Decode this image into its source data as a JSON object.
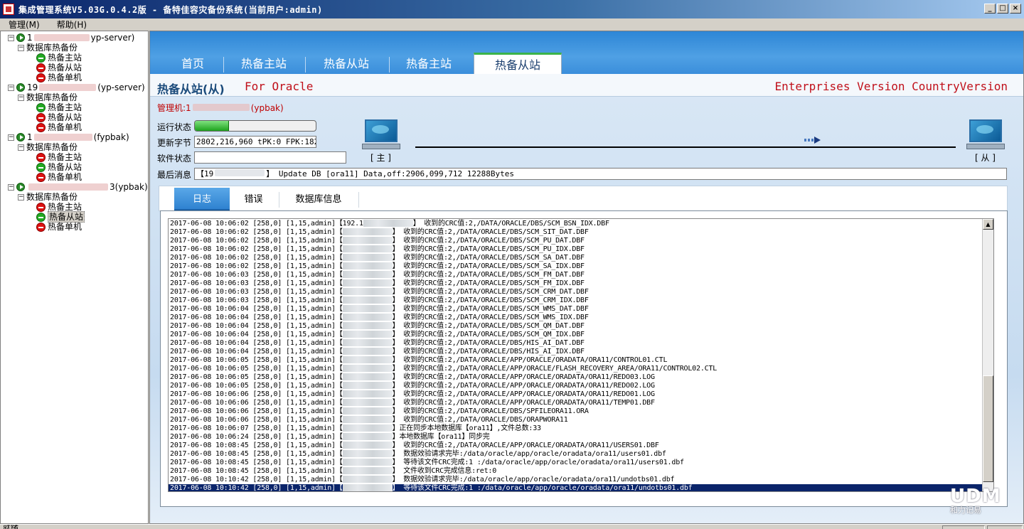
{
  "window": {
    "title": "集成管理系统V5.03G.0.4.2版 - 备特佳容灾备份系统(当前用户:admin)",
    "minimize": "_",
    "maximize": "□",
    "close": "×"
  },
  "menu": [
    {
      "label": "管理(M)"
    },
    {
      "label": "帮助(H)"
    }
  ],
  "tree": {
    "servers": [
      {
        "prefix": "1",
        "suffix": "yp-server)",
        "group": "数据库热备份",
        "children": [
          {
            "label": "热备主站",
            "status": "green"
          },
          {
            "label": "热备从站",
            "status": "red"
          },
          {
            "label": "热备单机",
            "status": "red"
          }
        ]
      },
      {
        "prefix": "19",
        "suffix": "(yp-server)",
        "group": "数据库热备份",
        "children": [
          {
            "label": "热备主站",
            "status": "green"
          },
          {
            "label": "热备从站",
            "status": "red"
          },
          {
            "label": "热备单机",
            "status": "red"
          }
        ]
      },
      {
        "prefix": "1",
        "suffix": "(fypbak)",
        "group": "数据库热备份",
        "children": [
          {
            "label": "热备主站",
            "status": "red"
          },
          {
            "label": "热备从站",
            "status": "green"
          },
          {
            "label": "热备单机",
            "status": "red"
          }
        ]
      },
      {
        "prefix": "",
        "suffix": "3(ypbak)",
        "group": "数据库热备份",
        "children": [
          {
            "label": "热备主站",
            "status": "red"
          },
          {
            "label": "热备从站",
            "status": "green",
            "selected": true
          },
          {
            "label": "热备单机",
            "status": "red"
          }
        ]
      }
    ]
  },
  "top_tabs": [
    {
      "label": "首页"
    },
    {
      "label": "热备主站"
    },
    {
      "label": "热备从站"
    },
    {
      "label": "热备主站"
    },
    {
      "label": "热备从站",
      "active": true
    }
  ],
  "header": {
    "title": "热备从站(从)",
    "subtitle": "For Oracle",
    "edition": "Enterprises Version CountryVersion"
  },
  "status_panel": {
    "manager_prefix": "管理机:1",
    "manager_suffix": "(ypbak)",
    "run_status_label": "运行状态",
    "run_progress": 0.28,
    "update_bytes_label": "更新字节",
    "update_bytes_value": "2802,216,960  tPK:0  FPK:18243",
    "software_status_label": "软件状态",
    "software_status_value": "",
    "last_message_label": "最后消息",
    "last_message_prefix": "【19",
    "last_message_text": "】 Update DB [ora11] Data,off:2906,099,712  12288Bytes",
    "master_label": "[ 主 ]",
    "slave_label": "[ 从 ]"
  },
  "inner_tabs": [
    {
      "label": "日志",
      "active": true
    },
    {
      "label": "错误"
    },
    {
      "label": "数据库信息"
    }
  ],
  "log": [
    {
      "ts": "2017-06-08 10:06:02",
      "code": "[258,0]",
      "user": "[1,15,admin]",
      "ip": "【192.1",
      "msg": "】 收到的CRC值:2,/DATA/ORACLE/DBS/SCM_BSN_IDX.DBF"
    },
    {
      "ts": "2017-06-08 10:06:02",
      "code": "[258,0]",
      "user": "[1,15,admin]",
      "ip": "【",
      "msg": "】 收到的CRC值:2,/DATA/ORACLE/DBS/SCM_SIT_DAT.DBF"
    },
    {
      "ts": "2017-06-08 10:06:02",
      "code": "[258,0]",
      "user": "[1,15,admin]",
      "ip": "【",
      "msg": "】 收到的CRC值:2,/DATA/ORACLE/DBS/SCM_PU_DAT.DBF"
    },
    {
      "ts": "2017-06-08 10:06:02",
      "code": "[258,0]",
      "user": "[1,15,admin]",
      "ip": "【",
      "msg": "】 收到的CRC值:2,/DATA/ORACLE/DBS/SCM_PU_IDX.DBF"
    },
    {
      "ts": "2017-06-08 10:06:02",
      "code": "[258,0]",
      "user": "[1,15,admin]",
      "ip": "【",
      "msg": "】 收到的CRC值:2,/DATA/ORACLE/DBS/SCM_SA_DAT.DBF"
    },
    {
      "ts": "2017-06-08 10:06:02",
      "code": "[258,0]",
      "user": "[1,15,admin]",
      "ip": "【",
      "msg": "】 收到的CRC值:2,/DATA/ORACLE/DBS/SCM_SA_IDX.DBF"
    },
    {
      "ts": "2017-06-08 10:06:03",
      "code": "[258,0]",
      "user": "[1,15,admin]",
      "ip": "【",
      "msg": "】 收到的CRC值:2,/DATA/ORACLE/DBS/SCM_FM_DAT.DBF"
    },
    {
      "ts": "2017-06-08 10:06:03",
      "code": "[258,0]",
      "user": "[1,15,admin]",
      "ip": "【",
      "msg": "】 收到的CRC值:2,/DATA/ORACLE/DBS/SCM_FM_IDX.DBF"
    },
    {
      "ts": "2017-06-08 10:06:03",
      "code": "[258,0]",
      "user": "[1,15,admin]",
      "ip": "【",
      "msg": "】 收到的CRC值:2,/DATA/ORACLE/DBS/SCM_CRM_DAT.DBF"
    },
    {
      "ts": "2017-06-08 10:06:03",
      "code": "[258,0]",
      "user": "[1,15,admin]",
      "ip": "【",
      "msg": "】 收到的CRC值:2,/DATA/ORACLE/DBS/SCM_CRM_IDX.DBF"
    },
    {
      "ts": "2017-06-08 10:06:04",
      "code": "[258,0]",
      "user": "[1,15,admin]",
      "ip": "【",
      "msg": "】 收到的CRC值:2,/DATA/ORACLE/DBS/SCM_WMS_DAT.DBF"
    },
    {
      "ts": "2017-06-08 10:06:04",
      "code": "[258,0]",
      "user": "[1,15,admin]",
      "ip": "【",
      "msg": "】 收到的CRC值:2,/DATA/ORACLE/DBS/SCM_WMS_IDX.DBF"
    },
    {
      "ts": "2017-06-08 10:06:04",
      "code": "[258,0]",
      "user": "[1,15,admin]",
      "ip": "【",
      "msg": "】 收到的CRC值:2,/DATA/ORACLE/DBS/SCM_QM_DAT.DBF"
    },
    {
      "ts": "2017-06-08 10:06:04",
      "code": "[258,0]",
      "user": "[1,15,admin]",
      "ip": "【",
      "msg": "】 收到的CRC值:2,/DATA/ORACLE/DBS/SCM_QM_IDX.DBF"
    },
    {
      "ts": "2017-06-08 10:06:04",
      "code": "[258,0]",
      "user": "[1,15,admin]",
      "ip": "【",
      "msg": "】 收到的CRC值:2,/DATA/ORACLE/DBS/HIS_AI_DAT.DBF"
    },
    {
      "ts": "2017-06-08 10:06:04",
      "code": "[258,0]",
      "user": "[1,15,admin]",
      "ip": "【",
      "msg": "】 收到的CRC值:2,/DATA/ORACLE/DBS/HIS_AI_IDX.DBF"
    },
    {
      "ts": "2017-06-08 10:06:05",
      "code": "[258,0]",
      "user": "[1,15,admin]",
      "ip": "【",
      "msg": "】 收到的CRC值:2,/DATA/ORACLE/APP/ORACLE/ORADATA/ORA11/CONTROL01.CTL"
    },
    {
      "ts": "2017-06-08 10:06:05",
      "code": "[258,0]",
      "user": "[1,15,admin]",
      "ip": "【",
      "msg": "】 收到的CRC值:2,/DATA/ORACLE/APP/ORACLE/FLASH_RECOVERY_AREA/ORA11/CONTROL02.CTL"
    },
    {
      "ts": "2017-06-08 10:06:05",
      "code": "[258,0]",
      "user": "[1,15,admin]",
      "ip": "【",
      "msg": "】 收到的CRC值:2,/DATA/ORACLE/APP/ORACLE/ORADATA/ORA11/REDO03.LOG"
    },
    {
      "ts": "2017-06-08 10:06:05",
      "code": "[258,0]",
      "user": "[1,15,admin]",
      "ip": "【",
      "msg": "】 收到的CRC值:2,/DATA/ORACLE/APP/ORACLE/ORADATA/ORA11/REDO02.LOG"
    },
    {
      "ts": "2017-06-08 10:06:06",
      "code": "[258,0]",
      "user": "[1,15,admin]",
      "ip": "【",
      "msg": "】 收到的CRC值:2,/DATA/ORACLE/APP/ORACLE/ORADATA/ORA11/REDO01.LOG"
    },
    {
      "ts": "2017-06-08 10:06:06",
      "code": "[258,0]",
      "user": "[1,15,admin]",
      "ip": "【",
      "msg": "】 收到的CRC值:2,/DATA/ORACLE/APP/ORACLE/ORADATA/ORA11/TEMP01.DBF"
    },
    {
      "ts": "2017-06-08 10:06:06",
      "code": "[258,0]",
      "user": "[1,15,admin]",
      "ip": "【",
      "msg": "】 收到的CRC值:2,/DATA/ORACLE/DBS/SPFILEORA11.ORA"
    },
    {
      "ts": "2017-06-08 10:06:06",
      "code": "[258,0]",
      "user": "[1,15,admin]",
      "ip": "【",
      "msg": "】 收到的CRC值:2,/DATA/ORACLE/DBS/ORAPWORA11"
    },
    {
      "ts": "2017-06-08 10:06:07",
      "code": "[258,0]",
      "user": "[1,15,admin]",
      "ip": "【",
      "msg": "】正在同步本地数据库【ora11】,文件总数:33"
    },
    {
      "ts": "2017-06-08 10:06:24",
      "code": "[258,0]",
      "user": "[1,15,admin]",
      "ip": "【",
      "msg": "】本地数据库【ora11】同步完"
    },
    {
      "ts": "2017-06-08 10:08:45",
      "code": "[258,0]",
      "user": "[1,15,admin]",
      "ip": "【",
      "msg": "】 收到的CRC值:2,/DATA/ORACLE/APP/ORACLE/ORADATA/ORA11/USERS01.DBF"
    },
    {
      "ts": "2017-06-08 10:08:45",
      "code": "[258,0]",
      "user": "[1,15,admin]",
      "ip": "【",
      "msg": "】 数据效验请求完毕:/data/oracle/app/oracle/oradata/ora11/users01.dbf"
    },
    {
      "ts": "2017-06-08 10:08:45",
      "code": "[258,0]",
      "user": "[1,15,admin]",
      "ip": "【",
      "msg": "】 等待该文件CRC完成:1 :/data/oracle/app/oracle/oradata/ora11/users01.dbf"
    },
    {
      "ts": "2017-06-08 10:08:45",
      "code": "[258,0]",
      "user": "[1,15,admin]",
      "ip": "【",
      "msg": "】 文件收到CRC完成信息:ret:0"
    },
    {
      "ts": "2017-06-08 10:10:42",
      "code": "[258,0]",
      "user": "[1,15,admin]",
      "ip": "【",
      "msg": "】 数据效验请求完毕:/data/oracle/app/oracle/oradata/ora11/undotbs01.dbf"
    },
    {
      "ts": "2017-06-08 10:10:42",
      "code": "[258,0]",
      "user": "[1,15,admin]",
      "ip": "【",
      "msg": "】 等待该文件CRC完成:1 :/data/oracle/app/oracle/oradata/ora11/undotbs01.dbf",
      "selected": true
    }
  ],
  "watermark": {
    "logo": "UDM",
    "text": "和力记易"
  },
  "statusbar": {
    "text": "就绪"
  }
}
